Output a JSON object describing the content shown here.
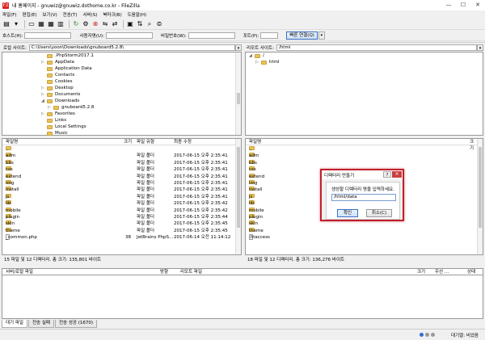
{
  "window": {
    "title": "내 홈페이지 - gnuwiz@gnuwiz.dothome.co.kr - FileZilla",
    "app_icon": "Fz",
    "minimize": "—",
    "maximize": "☐",
    "close": "✕"
  },
  "menu": [
    "파일(F)",
    "편집(E)",
    "보기(V)",
    "전송(T)",
    "서버(S)",
    "북마크(B)",
    "도움말(H)"
  ],
  "quickconnect": {
    "host_label": "호스트(H):",
    "user_label": "사용자명(U):",
    "pass_label": "비밀번호(W):",
    "port_label": "포트(P):",
    "host_value": "",
    "user_value": "",
    "pass_value": "",
    "port_value": "",
    "connect_button": "빠른 연결(Q)",
    "dropdown": "▾"
  },
  "local": {
    "site_label": "로컬 사이트:",
    "path": "C:\\Users\\yoon\\Downloads\\gnuboard5.2.8\\",
    "tree": [
      {
        "label": ".PhpStorm2017.1",
        "expander": ""
      },
      {
        "label": "AppData",
        "expander": "▷"
      },
      {
        "label": "Application Data",
        "expander": ""
      },
      {
        "label": "Contacts",
        "expander": ""
      },
      {
        "label": "Cookies",
        "expander": ""
      },
      {
        "label": "Desktop",
        "expander": "▷"
      },
      {
        "label": "Documents",
        "expander": "▷"
      },
      {
        "label": "Downloads",
        "expander": "◢"
      },
      {
        "label": "gnuboard5.2.8",
        "expander": "▷"
      },
      {
        "label": "Favorites",
        "expander": "▷"
      },
      {
        "label": "Links",
        "expander": ""
      },
      {
        "label": "Local Settings",
        "expander": ""
      },
      {
        "label": "Music",
        "expander": ""
      }
    ],
    "columns": {
      "name": "파일명",
      "size": "크기",
      "type": "파일 유형",
      "modified": "최종 수정"
    },
    "files": [
      {
        "name": "..",
        "size": "",
        "type": "",
        "modified": "",
        "kind": "folder"
      },
      {
        "name": "adm",
        "size": "",
        "type": "파일 폴더",
        "modified": "2017-06-15 오후 2:35:41",
        "kind": "folder"
      },
      {
        "name": "bbs",
        "size": "",
        "type": "파일 폴더",
        "modified": "2017-06-15 오후 2:35:41",
        "kind": "folder"
      },
      {
        "name": "css",
        "size": "",
        "type": "파일 폴더",
        "modified": "2017-06-15 오후 2:35:41",
        "kind": "folder"
      },
      {
        "name": "extend",
        "size": "",
        "type": "파일 폴더",
        "modified": "2017-06-15 오후 2:35:41",
        "kind": "folder"
      },
      {
        "name": "img",
        "size": "",
        "type": "파일 폴더",
        "modified": "2017-06-15 오후 2:35:41",
        "kind": "folder"
      },
      {
        "name": "install",
        "size": "",
        "type": "파일 폴더",
        "modified": "2017-06-15 오후 2:35:41",
        "kind": "folder"
      },
      {
        "name": "js",
        "size": "",
        "type": "파일 폴더",
        "modified": "2017-06-15 오후 2:35:41",
        "kind": "folder"
      },
      {
        "name": "lib",
        "size": "",
        "type": "파일 폴더",
        "modified": "2017-06-15 오후 2:35:42",
        "kind": "folder"
      },
      {
        "name": "mobile",
        "size": "",
        "type": "파일 폴더",
        "modified": "2017-06-15 오후 2:35:42",
        "kind": "folder"
      },
      {
        "name": "plugin",
        "size": "",
        "type": "파일 폴더",
        "modified": "2017-06-15 오후 2:35:44",
        "kind": "folder"
      },
      {
        "name": "skin",
        "size": "",
        "type": "파일 폴더",
        "modified": "2017-06-15 오후 2:35:45",
        "kind": "folder"
      },
      {
        "name": "theme",
        "size": "",
        "type": "파일 폴더",
        "modified": "2017-06-15 오후 2:35:45",
        "kind": "folder"
      },
      {
        "name": "_common.php",
        "size": "38",
        "type": "JetBrains PhpS...",
        "modified": "2017-06-14 오전 11:14:12",
        "kind": "file"
      }
    ],
    "status": "15 파일 및 12 디렉터리. 총 크기: 135,801 바이트"
  },
  "remote": {
    "site_label": "리모트 사이트:",
    "path": "/html",
    "tree": [
      {
        "label": "/",
        "expander": "◢"
      },
      {
        "label": "html",
        "expander": "▷"
      }
    ],
    "columns": {
      "name": "파일명",
      "size": "크기"
    },
    "files": [
      {
        "name": "..",
        "kind": "folder"
      },
      {
        "name": "adm",
        "kind": "folder"
      },
      {
        "name": "bbs",
        "kind": "folder"
      },
      {
        "name": "css",
        "kind": "folder"
      },
      {
        "name": "extend",
        "kind": "folder"
      },
      {
        "name": "img",
        "kind": "folder"
      },
      {
        "name": "install",
        "kind": "folder"
      },
      {
        "name": "js",
        "kind": "folder"
      },
      {
        "name": "lib",
        "kind": "folder"
      },
      {
        "name": "mobile",
        "kind": "folder"
      },
      {
        "name": "plugin",
        "kind": "folder"
      },
      {
        "name": "skin",
        "kind": "folder"
      },
      {
        "name": "theme",
        "kind": "folder"
      },
      {
        "name": ".htaccess",
        "kind": "file"
      }
    ],
    "status": "18 파일 및 12 디렉터리. 총 크기: 136,276 바이트"
  },
  "queue": {
    "columns": {
      "server_file": "서버/로컬 파일",
      "direction": "방향",
      "remote_file": "리모트 파일",
      "size": "크기",
      "priority": "우선 ...",
      "status": "상태"
    },
    "tabs": [
      "대기 파일",
      "전송 실패",
      "전송 성공 (1670)"
    ]
  },
  "statusbar": {
    "idle": "대기열: 비었음"
  },
  "dialog": {
    "title": "디렉터리 만들기",
    "help": "?",
    "close": "✕",
    "prompt": "생성할 디렉터리 명을 입력하세요.",
    "input_value": "/html/data",
    "ok": "확인",
    "cancel": "취소(C)"
  },
  "colors": {
    "dialog_border": "#c0202a",
    "accent": "#3b6fc4"
  }
}
